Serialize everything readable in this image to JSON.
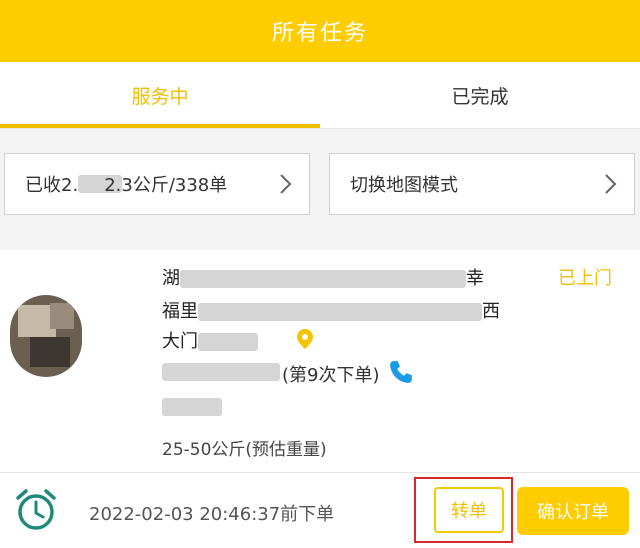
{
  "header": {
    "title": "所有任务"
  },
  "tabs": [
    {
      "label": "服务中",
      "active": true
    },
    {
      "label": "已完成",
      "active": false
    }
  ],
  "summary": {
    "collected_prefix": "已收2.",
    "collected_suffix": "2.3公斤/338单",
    "map_mode_label": "切换地图模式"
  },
  "order": {
    "status": "已上门",
    "address_line1_start": "湖",
    "address_line1_end": "幸",
    "address_line2_start": "福里",
    "address_line2_end": "西",
    "address_line3_start": "大门",
    "order_count_text": "(第9次下单)",
    "weight_estimate": "25-50公斤(预估重量)"
  },
  "footer": {
    "timestamp": "2022-02-03 20:46:37前下单",
    "transfer_label": "转单",
    "confirm_label": "确认订单"
  },
  "colors": {
    "brand_yellow": "#ffcc00",
    "accent_text": "#f0bf00",
    "phone_blue": "#1a9be6",
    "alarm_teal": "#1f8a7c",
    "highlight_red": "#d8272e"
  },
  "icons": {
    "box_chevron": "chevron-right-icon",
    "pin": "location-pin-icon",
    "phone": "phone-icon",
    "alarm": "alarm-clock-icon"
  }
}
